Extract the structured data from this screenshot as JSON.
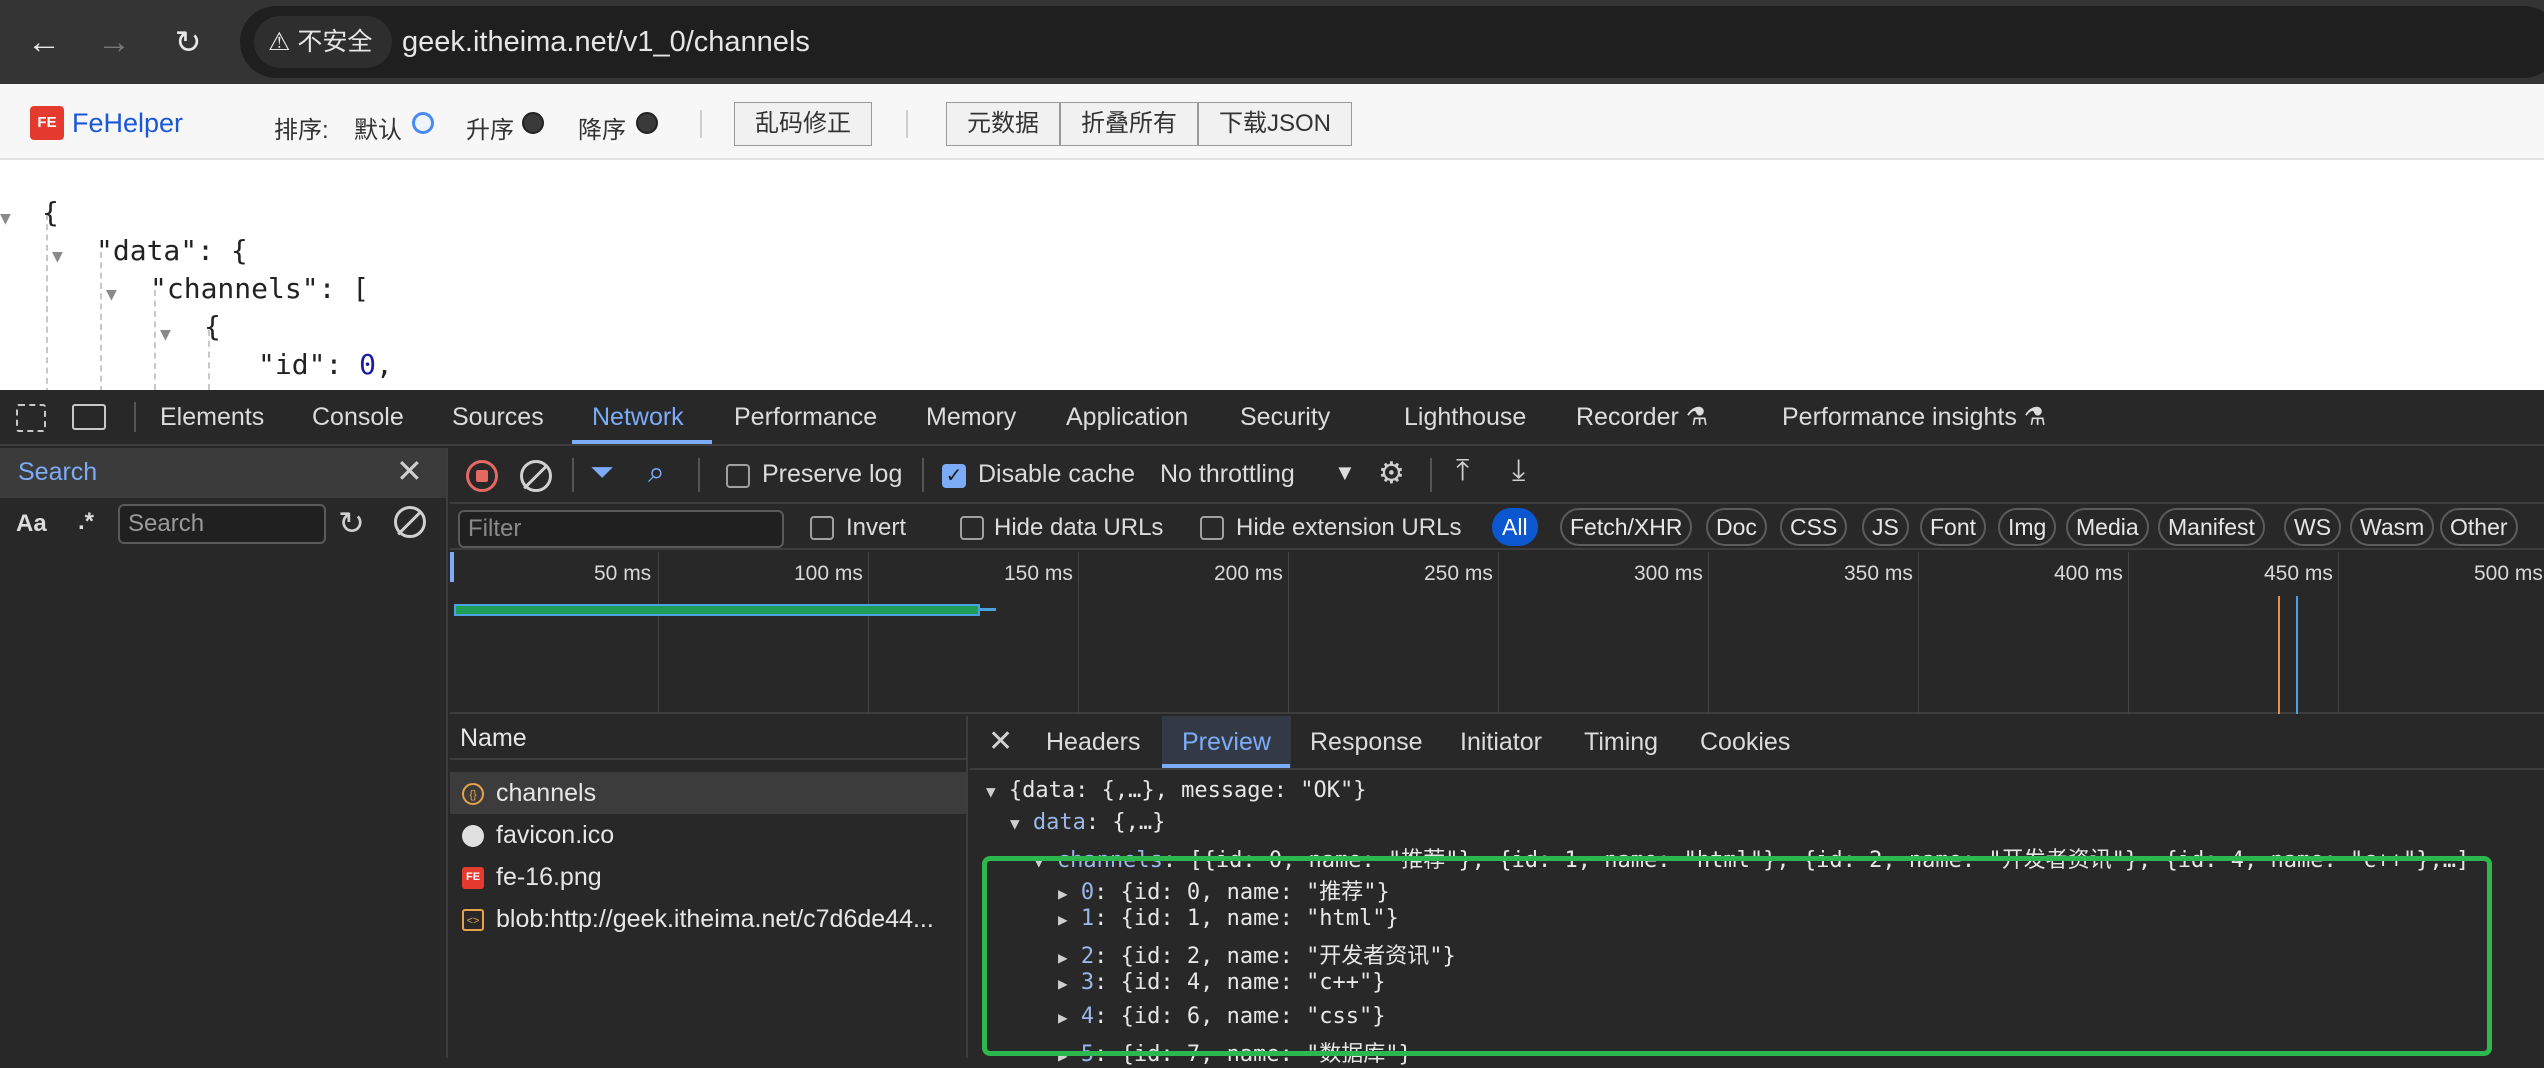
{
  "browser": {
    "security_label": "不安全",
    "url": "geek.itheima.net/v1_0/channels"
  },
  "fehelper": {
    "name": "FeHelper",
    "sort_label": "排序:",
    "sort_default": "默认",
    "sort_asc": "升序",
    "sort_desc": "降序",
    "fix_encoding": "乱码修正",
    "metadata": "元数据",
    "collapse_all": "折叠所有",
    "download_json": "下载JSON"
  },
  "json_view": {
    "open_brace": "{",
    "data_key": "\"data\"",
    "data_open": ": {",
    "channels_key": "\"channels\"",
    "channels_open": ": [",
    "item_open": "{",
    "id_key": "\"id\"",
    "id_sep": ": ",
    "id_value": "0",
    "comma": ","
  },
  "devtools": {
    "tabs": [
      "Elements",
      "Console",
      "Sources",
      "Network",
      "Performance",
      "Memory",
      "Application",
      "Security",
      "Lighthouse",
      "Recorder",
      "Performance insights"
    ],
    "active_tab": "Network",
    "search_panel": {
      "title": "Search",
      "case_label": "Aa",
      "regex_label": ".*",
      "placeholder": "Search"
    },
    "network_toolbar": {
      "preserve_log": "Preserve log",
      "disable_cache": "Disable cache",
      "throttling": "No throttling"
    },
    "filter": {
      "placeholder": "Filter",
      "invert": "Invert",
      "hide_data_urls": "Hide data URLs",
      "hide_extension_urls": "Hide extension URLs",
      "types": [
        "All",
        "Fetch/XHR",
        "Doc",
        "CSS",
        "JS",
        "Font",
        "Img",
        "Media",
        "Manifest",
        "WS",
        "Wasm",
        "Other"
      ],
      "active_type": "All"
    },
    "timeline": {
      "ticks": [
        "50 ms",
        "100 ms",
        "150 ms",
        "200 ms",
        "250 ms",
        "300 ms",
        "350 ms",
        "400 ms",
        "450 ms",
        "500 ms"
      ],
      "colors": {
        "bar": "#1e9e58",
        "bar_edge": "#4aa3df",
        "dcl_line": "#e8904a",
        "load_line": "#4aa3df"
      }
    },
    "requests": {
      "header": "Name",
      "items": [
        {
          "name": "channels",
          "icon": "xhr-icon"
        },
        {
          "name": "favicon.ico",
          "icon": "image-icon"
        },
        {
          "name": "fe-16.png",
          "icon": "fe-icon"
        },
        {
          "name": "blob:http://geek.itheima.net/c7d6de44...",
          "icon": "script-icon"
        }
      ],
      "selected": "channels"
    },
    "preview": {
      "tabs": [
        "Headers",
        "Preview",
        "Response",
        "Initiator",
        "Timing",
        "Cookies"
      ],
      "active_tab": "Preview",
      "root_summary": "{data: {,…}, message: \"OK\"}",
      "data_key": "data",
      "data_summary": ": {,…}",
      "channels_key": "channels",
      "channels_summary": ": [{id: 0, name: \"推荐\"}, {id: 1, name: \"html\"}, {id: 2, name: \"开发者资讯\"}, {id: 4, name: \"c++\"},…]",
      "items": [
        {
          "index": "0",
          "text": ": {id: 0, name: \"推荐\"}"
        },
        {
          "index": "1",
          "text": ": {id: 1, name: \"html\"}"
        },
        {
          "index": "2",
          "text": ": {id: 2, name: \"开发者资讯\"}"
        },
        {
          "index": "3",
          "text": ": {id: 4, name: \"c++\"}"
        },
        {
          "index": "4",
          "text": ": {id: 6, name: \"css\"}"
        },
        {
          "index": "5",
          "text": ": {id: 7, name: \"数据库\"}"
        }
      ],
      "highlight_color": "#2db84d"
    }
  }
}
